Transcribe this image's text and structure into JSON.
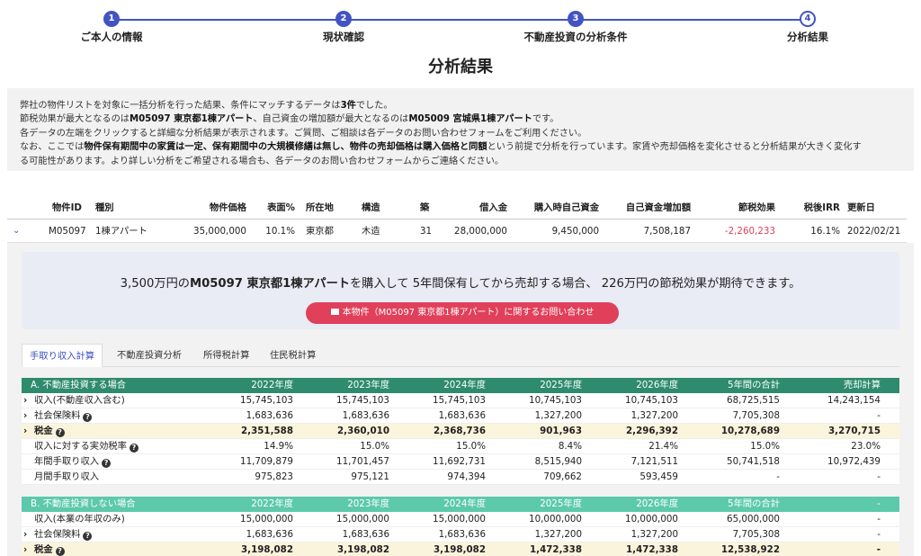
{
  "stepper": {
    "steps": [
      {
        "num": "1",
        "label": "ご本人の情報"
      },
      {
        "num": "2",
        "label": "現状確認"
      },
      {
        "num": "3",
        "label": "不動産投資の分析条件"
      },
      {
        "num": "4",
        "label": "分析結果"
      }
    ]
  },
  "page_title": "分析結果",
  "summary": {
    "l1a": "弊社の物件リストを対象に一括分析を行った結果、条件にマッチするデータは",
    "l1b": "3件",
    "l1c": "でした。",
    "l2a": "節税効果が最大となるのは",
    "l2b": "M05097 東京都1棟アパート",
    "l2c": "、自己資金の増加額が最大となるのは",
    "l2d": "M05009 宮城県1棟アパート",
    "l2e": "です。",
    "l3": "各データの左端をクリックすると詳細な分析結果が表示されます。ご質問、ご相談は各データのお問い合わせフォームをご利用ください。",
    "l4a": "なお、ここでは",
    "l4b": "物件保有期間中の家賃は一定、保有期間中の大規模修繕は無し、物件の売却価格は購入価格と同額",
    "l4c": "という前提で分析を行っています。家賃や売却価格を変化させると分析結果が大きく変化す",
    "l5": "る可能性があります。より詳しい分析をご希望される場合も、各データのお問い合わせフォームからご連絡ください。"
  },
  "property_table": {
    "headers": [
      "物件ID",
      "種別",
      "物件価格",
      "表面%",
      "所在地",
      "構造",
      "築",
      "借入金",
      "購入時自己資金",
      "自己資金増加額",
      "節税効果",
      "税後IRR",
      "更新日"
    ],
    "row": {
      "expand_icon": "chevron-down-icon",
      "id": "M05097",
      "type": "1棟アパート",
      "price": "35,000,000",
      "yield": "10.1%",
      "location": "東京都",
      "structure": "木造",
      "age": "31",
      "loan": "28,000,000",
      "equity": "9,450,000",
      "equity_increase": "7,508,187",
      "tax_effect": "-2,260,233",
      "irr": "16.1%",
      "updated": "2022/02/21"
    }
  },
  "callout": {
    "p1": "3,500万円の",
    "p2": "M05097 東京都1棟アパート",
    "p3": "を購入して 5年間保有してから売却する場合、 226万円の節税効果が期待できます。",
    "button_label": "本物件（M05097 東京都1棟アパート）に関するお問い合わせ"
  },
  "tabs": [
    "手取り収入計算",
    "不動産投資分析",
    "所得税計算",
    "住民税計算"
  ],
  "section_a": {
    "title": "A. 不動産投資する場合",
    "columns": [
      "2022年度",
      "2023年度",
      "2024年度",
      "2025年度",
      "2026年度",
      "5年間の合計",
      "売却計算"
    ],
    "rows": [
      {
        "label": "収入(不動産収入含む)",
        "values": [
          "15,745,103",
          "15,745,103",
          "15,745,103",
          "10,745,103",
          "10,745,103",
          "68,725,515",
          "14,243,154"
        ]
      },
      {
        "label": "社会保険料",
        "values": [
          "1,683,636",
          "1,683,636",
          "1,683,636",
          "1,327,200",
          "1,327,200",
          "7,705,308",
          "-"
        ]
      },
      {
        "label": "税金",
        "values": [
          "2,351,588",
          "2,360,010",
          "2,368,736",
          "901,963",
          "2,296,392",
          "10,278,689",
          "3,270,715"
        ]
      },
      {
        "label": "収入に対する実効税率",
        "values": [
          "14.9%",
          "15.0%",
          "15.0%",
          "8.4%",
          "21.4%",
          "15.0%",
          "23.0%"
        ]
      },
      {
        "label": "年間手取り収入",
        "values": [
          "11,709,879",
          "11,701,457",
          "11,692,731",
          "8,515,940",
          "7,121,511",
          "50,741,518",
          "10,972,439"
        ]
      },
      {
        "label": "月間手取り収入",
        "values": [
          "975,823",
          "975,121",
          "974,394",
          "709,662",
          "593,459",
          "-",
          "-"
        ]
      }
    ]
  },
  "section_b": {
    "title": "B. 不動産投資しない場合",
    "columns": [
      "2022年度",
      "2023年度",
      "2024年度",
      "2025年度",
      "2026年度",
      "5年間の合計",
      "-"
    ],
    "rows": [
      {
        "label": "収入(本業の年収のみ)",
        "values": [
          "15,000,000",
          "15,000,000",
          "15,000,000",
          "10,000,000",
          "10,000,000",
          "65,000,000",
          "-"
        ]
      },
      {
        "label": "社会保険料",
        "values": [
          "1,683,636",
          "1,683,636",
          "1,683,636",
          "1,327,200",
          "1,327,200",
          "7,705,308",
          "-"
        ]
      },
      {
        "label": "税金",
        "values": [
          "3,198,082",
          "3,198,082",
          "3,198,082",
          "1,472,338",
          "1,472,338",
          "12,538,922",
          "-"
        ]
      }
    ]
  },
  "colors": {
    "accent": "#4254c3",
    "header_a": "#2e8b6e",
    "header_b": "#5cc9ab",
    "cta": "#e0405a",
    "negative": "#e0405a",
    "highlight": "#fbf4dc"
  }
}
